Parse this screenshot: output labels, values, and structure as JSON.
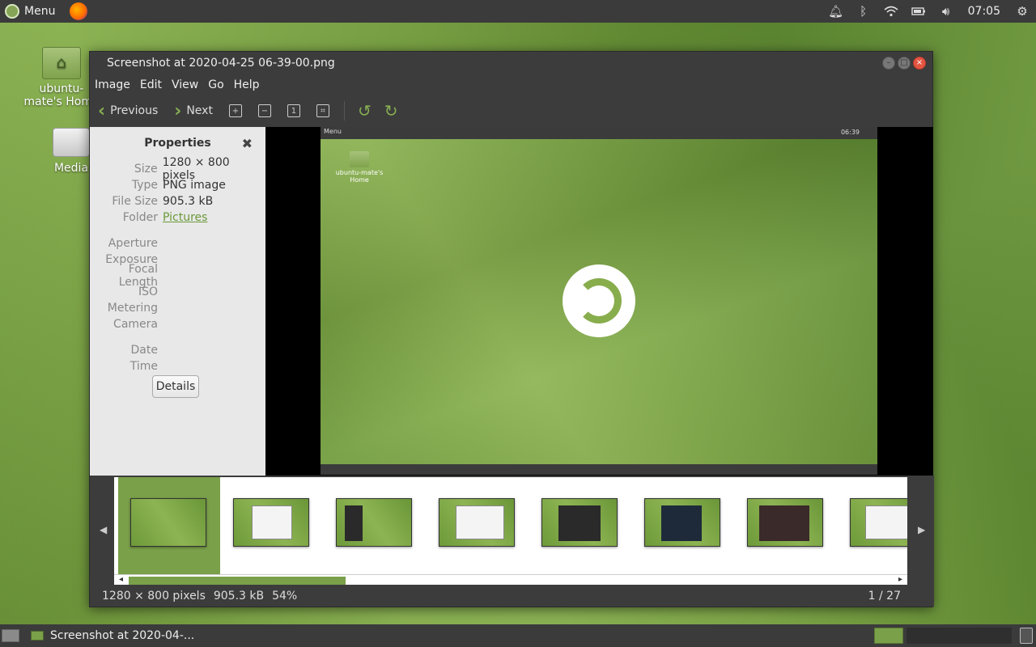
{
  "top_panel": {
    "menu_label": "Menu",
    "clock": "07:05"
  },
  "desktop": {
    "home_label": "ubuntu-mate's Home",
    "media_label": "Media"
  },
  "window": {
    "title": "Screenshot at 2020-04-25 06-39-00.png",
    "menu": [
      "Image",
      "Edit",
      "View",
      "Go",
      "Help"
    ],
    "toolbar": {
      "previous": "Previous",
      "next": "Next"
    }
  },
  "properties": {
    "title": "Properties",
    "rows": [
      {
        "key": "Size",
        "value": "1280 × 800 pixels"
      },
      {
        "key": "Type",
        "value": "PNG image"
      },
      {
        "key": "File Size",
        "value": "905.3 kB"
      },
      {
        "key": "Folder",
        "value": "Pictures"
      }
    ],
    "exif_keys": [
      "Aperture",
      "Exposure",
      "Focal Length",
      "ISO",
      "Metering",
      "Camera"
    ],
    "date_keys": [
      "Date",
      "Time"
    ],
    "details_button": "Details"
  },
  "image_preview": {
    "panel_menu": "Menu",
    "panel_clock": "06:39",
    "home_label": "ubuntu-mate's Home"
  },
  "status": {
    "dimensions": "1280 × 800 pixels",
    "file_size": "905.3 kB",
    "zoom": "54%",
    "position": "1 / 27"
  },
  "taskbar": {
    "task_label": "Screenshot at 2020-04-..."
  },
  "colors": {
    "accent": "#87a556",
    "panel": "#3b3b3b",
    "close": "#e45542"
  }
}
